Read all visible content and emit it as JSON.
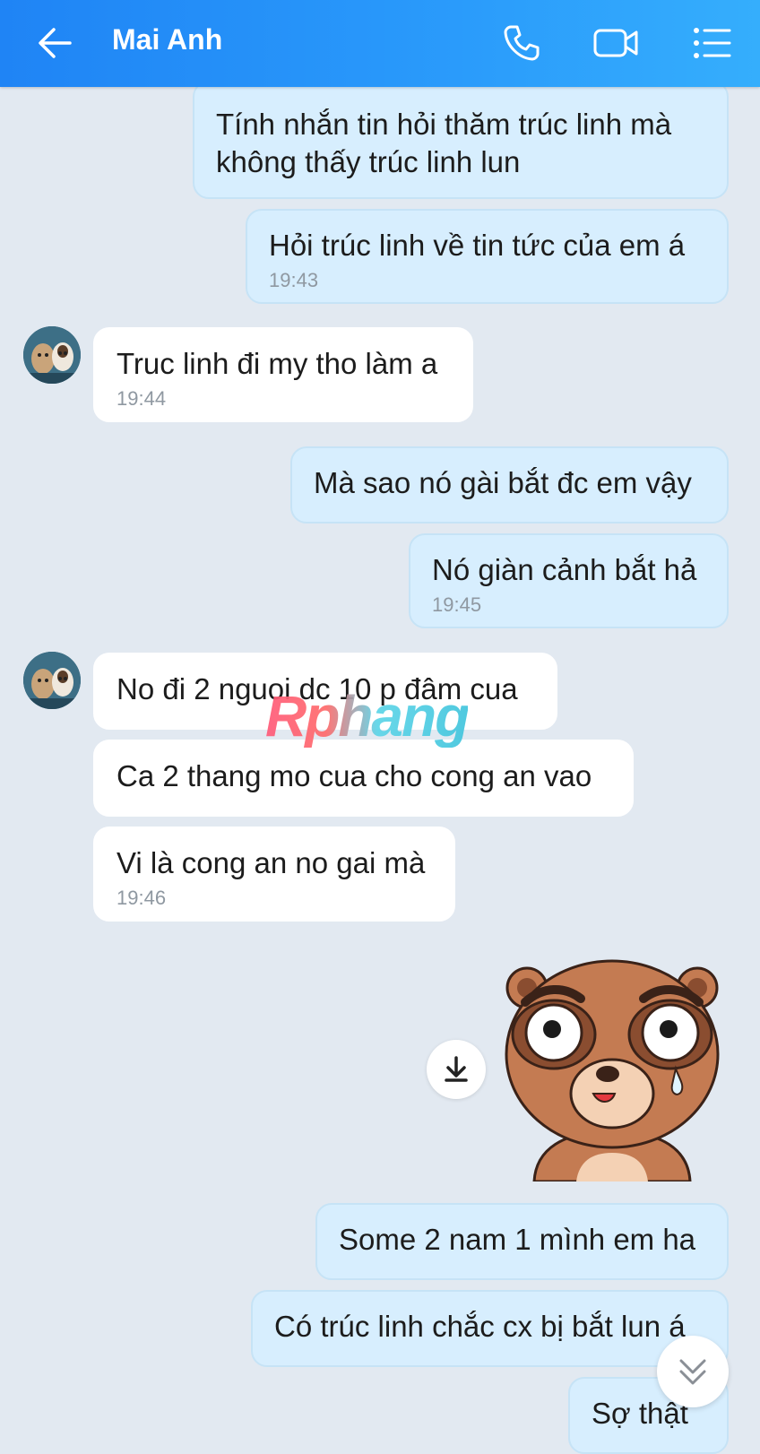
{
  "header": {
    "contact_name": "Mai Anh"
  },
  "icons": {
    "back": "arrow-left-icon",
    "call": "phone-icon",
    "video": "video-camera-icon",
    "menu": "list-menu-icon",
    "download": "download-icon",
    "scroll": "double-chevron-down-icon"
  },
  "watermark": "Rphang",
  "messages": [
    {
      "text": "Tính nhắn tin hỏi thăm trúc linh mà không thấy trúc linh lun",
      "time": ""
    },
    {
      "text": "Hỏi trúc linh về tin tức của em á",
      "time": "19:43"
    },
    {
      "text": "Truc linh đi my tho làm a",
      "time": "19:44"
    },
    {
      "text": "Mà sao nó gài bắt đc em vậy",
      "time": ""
    },
    {
      "text": "Nó giàn cảnh bắt hả",
      "time": "19:45"
    },
    {
      "text": "No đi 2 nguoi dc 10 p đâm cua",
      "time": ""
    },
    {
      "text": "Ca 2 thang mo cua cho cong an vao",
      "time": ""
    },
    {
      "text": "Vi là cong an no gai mà",
      "time": "19:46"
    },
    {
      "text": "Some 2 nam 1 mình em ha",
      "time": ""
    },
    {
      "text": "Có trúc linh chắc cx bị bắt lun á",
      "time": ""
    },
    {
      "text": "Sợ thật",
      "time": ""
    }
  ],
  "colors": {
    "header_start": "#1f84f5",
    "header_end": "#35aefc",
    "background": "#e2e9f1",
    "outgoing_bubble": "#d7eefe",
    "incoming_bubble": "#ffffff"
  }
}
